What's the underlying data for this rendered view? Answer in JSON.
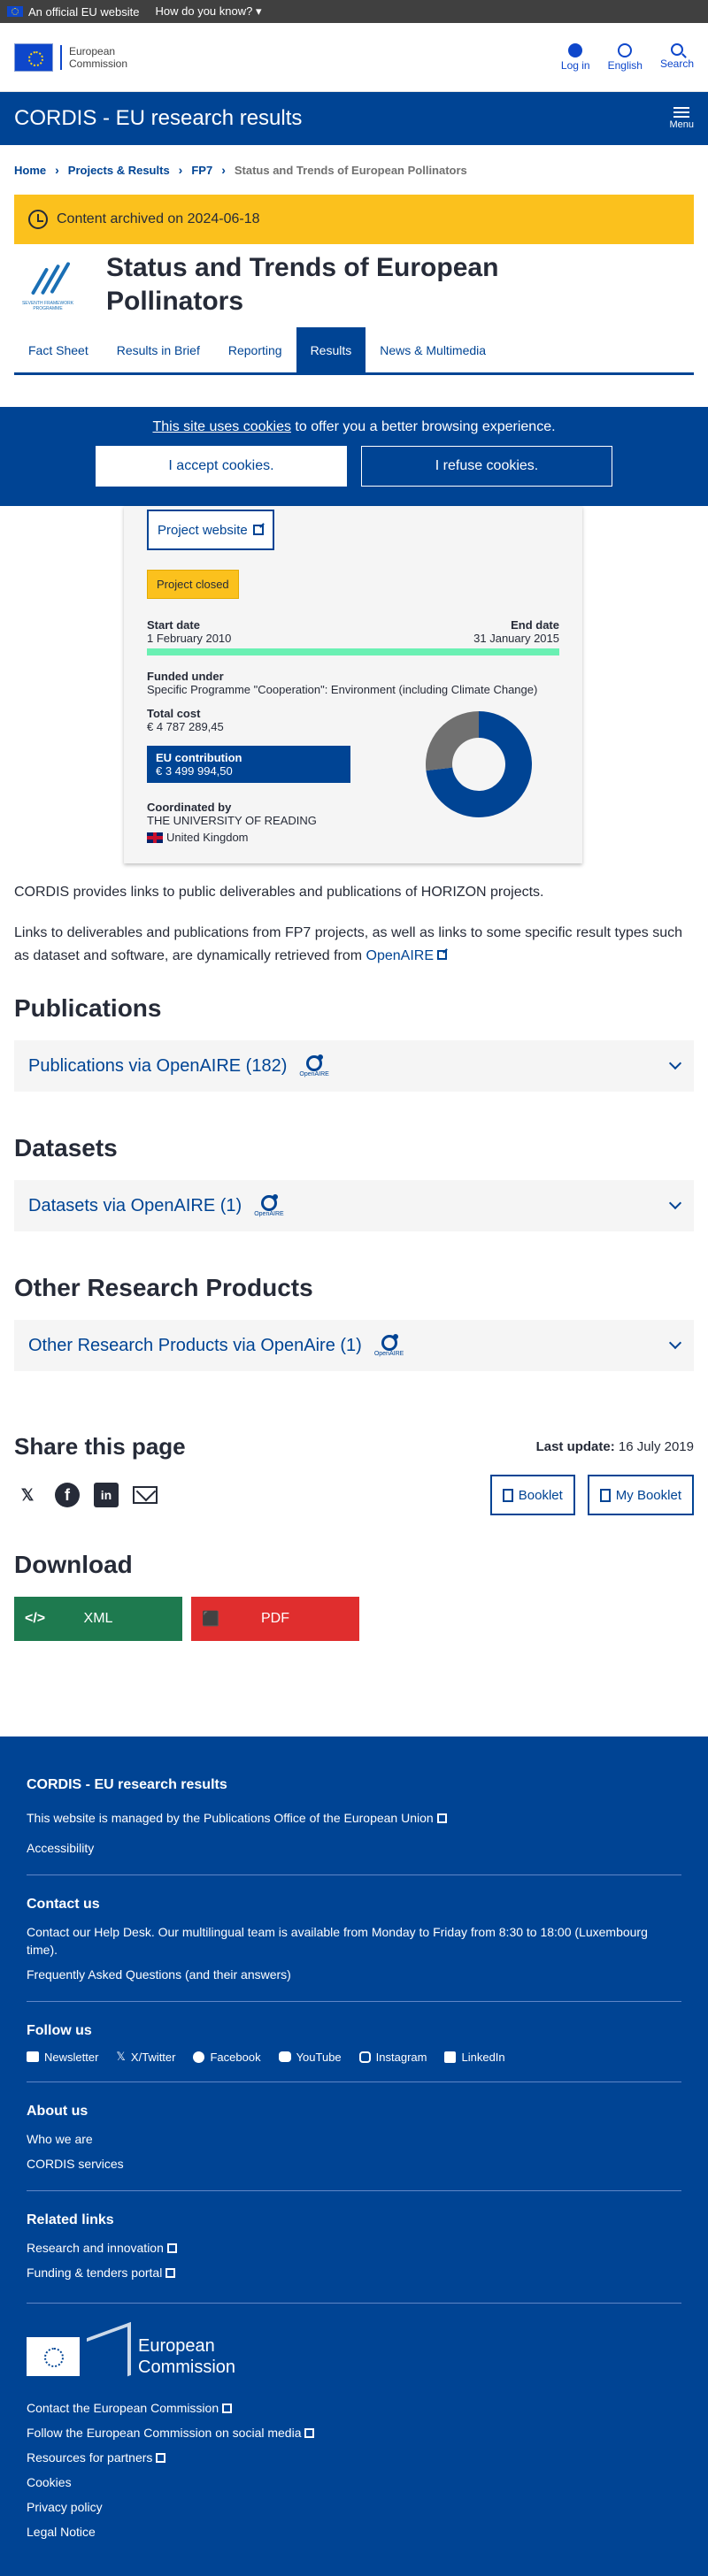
{
  "eu_bar": {
    "text": "An official EU website",
    "how": "How do you know?"
  },
  "header": {
    "logo_line1": "European",
    "logo_line2": "Commission",
    "login": "Log in",
    "language": "English",
    "search": "Search"
  },
  "site": {
    "title": "CORDIS - EU research results",
    "menu": "Menu"
  },
  "breadcrumb": [
    "Home",
    "Projects & Results",
    "FP7",
    "Status and Trends of European Pollinators"
  ],
  "archive": "Content archived on 2024-06-18",
  "project": {
    "title": "Status and Trends of European Pollinators",
    "fp7_caption": "SEVENTH FRAMEWORK PROGRAMME"
  },
  "tabs": [
    "Fact Sheet",
    "Results in Brief",
    "Reporting",
    "Results",
    "News & Multimedia"
  ],
  "active_tab": "Results",
  "cookie": {
    "link": "This site uses cookies",
    "text": " to offer you a better browsing experience.",
    "accept": "I accept cookies.",
    "refuse": "I refuse cookies."
  },
  "card": {
    "website": "Project website",
    "status": "Project closed",
    "start_label": "Start date",
    "start": "1 February 2010",
    "end_label": "End date",
    "end": "31 January 2015",
    "progress_fraction": 1.0,
    "funded_label": "Funded under",
    "funded": "Specific Programme \"Cooperation\": Environment (including Climate Change)",
    "cost_label": "Total cost",
    "cost": "€ 4 787 289,45",
    "contrib_label": "EU contribution",
    "contrib": "€ 3 499 994,50",
    "coord_label": "Coordinated by",
    "coord": "THE UNIVERSITY OF READING",
    "country": "United Kingdom"
  },
  "chart_data": {
    "type": "pie",
    "categories": [
      "EU contribution",
      "Other"
    ],
    "values": [
      3499994.5,
      1287294.95
    ],
    "colors": [
      "#004494",
      "#707070"
    ]
  },
  "intro": {
    "p1": "CORDIS provides links to public deliverables and publications of HORIZON projects.",
    "p2": "Links to deliverables and publications from FP7 projects, as well as links to some specific result types such as dataset and software, are dynamically retrieved from ",
    "p2_link": "OpenAIRE"
  },
  "sections": [
    {
      "heading": "Publications",
      "item": "Publications via OpenAIRE (182)"
    },
    {
      "heading": "Datasets",
      "item": "Datasets via OpenAIRE (1)"
    },
    {
      "heading": "Other Research Products",
      "item": "Other Research Products via OpenAire (1)"
    }
  ],
  "openaire_label": "OpenAIRE",
  "share": {
    "heading": "Share this page",
    "last_update_label": "Last update:",
    "last_update": "16 July 2019",
    "booklet": "Booklet",
    "my_booklet": "My Booklet"
  },
  "download": {
    "heading": "Download",
    "xml": "XML",
    "pdf": "PDF"
  },
  "footer": {
    "title": "CORDIS - EU research results",
    "managed_pre": "This website is managed by the ",
    "managed_link": "Publications Office of the European Union",
    "accessibility": "Accessibility",
    "contact_h": "Contact us",
    "helpdesk_link": "Contact our Help Desk",
    "helpdesk_text": ". Our multilingual team is available from Monday to Friday from 8:30 to 18:00 (Luxembourg time).",
    "faq_link": "Frequently Asked Questions",
    "faq_text": " (and their answers)",
    "follow_h": "Follow us",
    "follow": [
      "Newsletter",
      "X/Twitter",
      "Facebook",
      "YouTube",
      "Instagram",
      "LinkedIn"
    ],
    "about_h": "About us",
    "about": [
      "Who we are",
      "CORDIS services"
    ],
    "related_h": "Related links",
    "related": [
      "Research and innovation",
      "Funding & tenders portal"
    ],
    "ec_line1": "European",
    "ec_line2": "Commission",
    "ec_links": [
      "Contact the European Commission",
      "Follow the European Commission on social media",
      "Resources for partners",
      "Cookies",
      "Privacy policy",
      "Legal Notice"
    ]
  }
}
